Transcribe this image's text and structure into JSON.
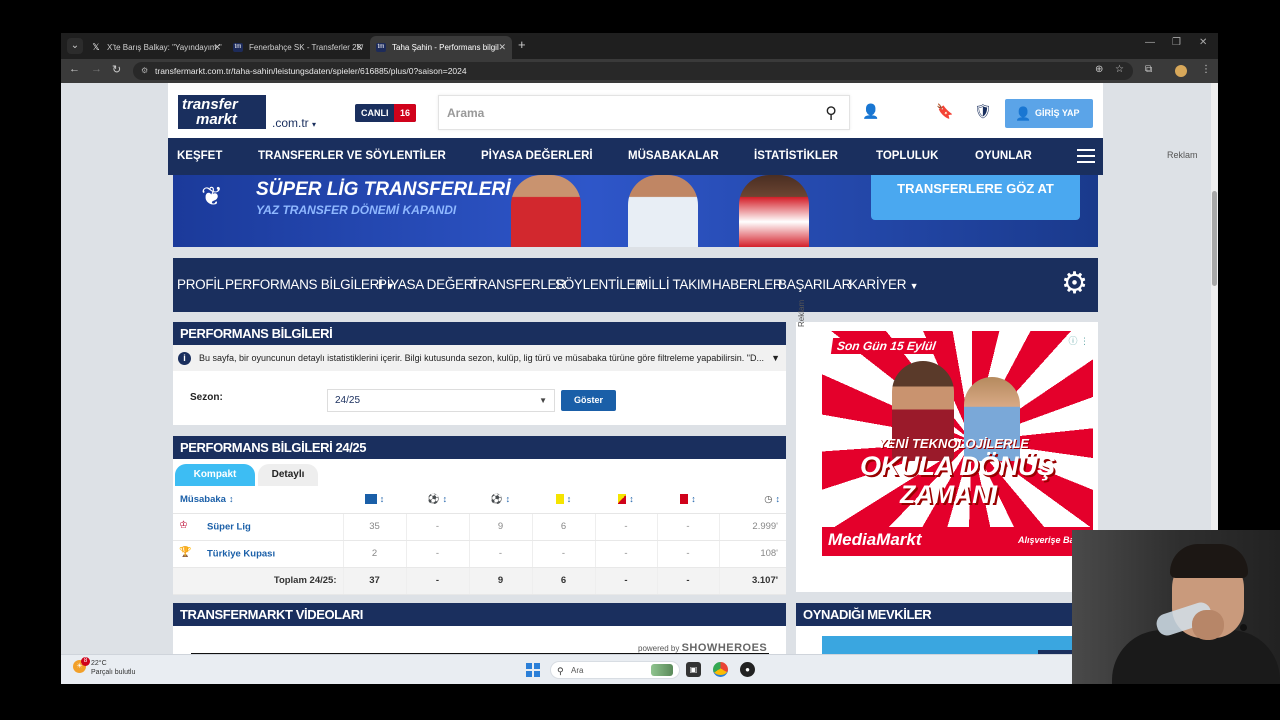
{
  "browser": {
    "tabs": [
      {
        "title": "X'te Barış Balkay: \"Yayındayım.\"",
        "active": false,
        "favicon": "x-logo"
      },
      {
        "title": "Fenerbahçe SK - Transferler 25/",
        "active": false,
        "favicon": "tm-logo"
      },
      {
        "title": "Taha Şahin - Performans bilgil",
        "active": true,
        "favicon": "tm-logo"
      }
    ],
    "new_tab": "+",
    "url": "transfermarkt.com.tr/taha-sahin/leistungsdaten/spieler/616885/plus/0?saison=2024"
  },
  "header": {
    "logo_line1": "transfer",
    "logo_line2": "markt",
    "domain": ".com.tr",
    "live_label": "CANLI",
    "live_count": "16",
    "search_placeholder": "Arama",
    "login_label": "GİRİŞ YAP"
  },
  "main_nav": [
    "KEŞFET",
    "TRANSFERLER VE SÖYLENTİLER",
    "PİYASA DEĞERLERİ",
    "MÜSABAKALAR",
    "İSTATİSTİKLER",
    "TOPLULUK",
    "OYUNLAR"
  ],
  "side_ad_label": "Reklam",
  "banner": {
    "title": "SÜPER LİG TRANSFERLERİ",
    "subtitle": "YAZ TRANSFER DÖNEMİ KAPANDI",
    "cta": "TRANSFERLERE GÖZ AT"
  },
  "sub_nav": [
    {
      "label": "PROFİL",
      "dropdown": false
    },
    {
      "label": "PERFORMANS BİLGİLERİ",
      "dropdown": true
    },
    {
      "label": "PİYASA DEĞERİ",
      "dropdown": false
    },
    {
      "label": "TRANSFERLER",
      "dropdown": false
    },
    {
      "label": "SÖYLENTİLER",
      "dropdown": false
    },
    {
      "label": "MİLLİ TAKIM",
      "dropdown": false
    },
    {
      "label": "HABERLER",
      "dropdown": false
    },
    {
      "label": "BAŞARILAR",
      "dropdown": false
    },
    {
      "label": "KARİYER",
      "dropdown": true
    }
  ],
  "perf_box": {
    "title": "PERFORMANS BİLGİLERİ",
    "info": "Bu sayfa, bir oyuncunun detaylı istatistiklerini içerir. Bilgi kutusunda sezon, kulüp, lig türü ve müsabaka türüne göre filtreleme yapabilirsin. \"D...",
    "season_label": "Sezon:",
    "season_value": "24/25",
    "show_button": "Göster"
  },
  "stats": {
    "title": "PERFORMANS BİLGİLERİ 24/25",
    "tabs": [
      "Kompakt",
      "Detaylı"
    ],
    "column_header": "Müsabaka",
    "column_icons": [
      "appearances-icon",
      "goals-icon",
      "assists-icon",
      "yellow-card-icon",
      "yellow-red-card-icon",
      "red-card-icon",
      "minutes-icon"
    ],
    "rows": [
      {
        "competition": "Süper Lig",
        "values": [
          "35",
          "-",
          "9",
          "6",
          "-",
          "-",
          "2.999'"
        ]
      },
      {
        "competition": "Türkiye Kupası",
        "values": [
          "2",
          "-",
          "-",
          "-",
          "-",
          "-",
          "108'"
        ]
      }
    ],
    "total_label": "Toplam 24/25:",
    "total_values": [
      "37",
      "-",
      "9",
      "6",
      "-",
      "-",
      "3.107'"
    ]
  },
  "ad": {
    "label": "Reklam",
    "tag": "Son Gün 15 Eylül",
    "line1": "YENİ TEKNOLOJİLERLE",
    "line2": "OKULA DÖNÜŞ",
    "line3": "ZAMANI",
    "brand": "MediaMarkt",
    "cta": "Alışverişe Başla"
  },
  "videos": {
    "title": "TRANSFERMARKT VİDEOLARI",
    "powered_by": "powered by",
    "powered_brand": "SHOWHEROES"
  },
  "positions": {
    "title": "OYNADIĞI MEVKİLER"
  },
  "taskbar": {
    "weather_temp": "22°C",
    "weather_desc": "Parçalı bulutlu",
    "weather_badge": "8",
    "search_placeholder": "Ara"
  },
  "colors": {
    "navy": "#1a2f5e",
    "accent_blue": "#3dbdf3",
    "link_blue": "#1a5fa8",
    "ad_red": "#e4002b"
  }
}
